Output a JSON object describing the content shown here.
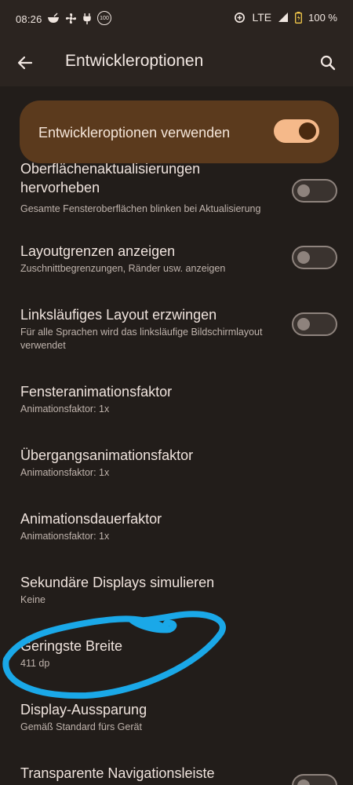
{
  "status": {
    "time": "08:26",
    "network": "LTE",
    "battery": "100 %",
    "badge": "100"
  },
  "header": {
    "title": "Entwickleroptionen"
  },
  "master": {
    "label": "Entwickleroptionen verwenden",
    "enabled": true
  },
  "items": [
    {
      "title": "Oberflächenaktualisierungen hervorheben",
      "subtitle": "Gesamte Fensteroberflächen blinken bei Aktualisierung",
      "toggle": false
    },
    {
      "title": "Layoutgrenzen anzeigen",
      "subtitle": "Zuschnittbegrenzungen, Ränder usw. anzeigen",
      "toggle": false
    },
    {
      "title": "Linksläufiges Layout erzwingen",
      "subtitle": "Für alle Sprachen wird das linksläufige Bildschirmlayout verwendet",
      "toggle": false
    },
    {
      "title": "Fensteranimationsfaktor",
      "subtitle": "Animationsfaktor: 1x"
    },
    {
      "title": "Übergangsanimationsfaktor",
      "subtitle": "Animationsfaktor: 1x"
    },
    {
      "title": "Animationsdauerfaktor",
      "subtitle": "Animationsfaktor: 1x"
    },
    {
      "title": "Sekundäre Displays simulieren",
      "subtitle": "Keine"
    },
    {
      "title": "Geringste Breite",
      "subtitle": "411 dp"
    },
    {
      "title": "Display-Aussparung",
      "subtitle": "Gemäß Standard fürs Gerät"
    },
    {
      "title": "Transparente Navigationsleiste",
      "toggle": false
    }
  ],
  "colors": {
    "background": "#221d1a",
    "appbar": "#2b2420",
    "master_card": "#5b3a1d",
    "toggle_on": "#f5b98a",
    "annotation": "#1aa8e8"
  }
}
